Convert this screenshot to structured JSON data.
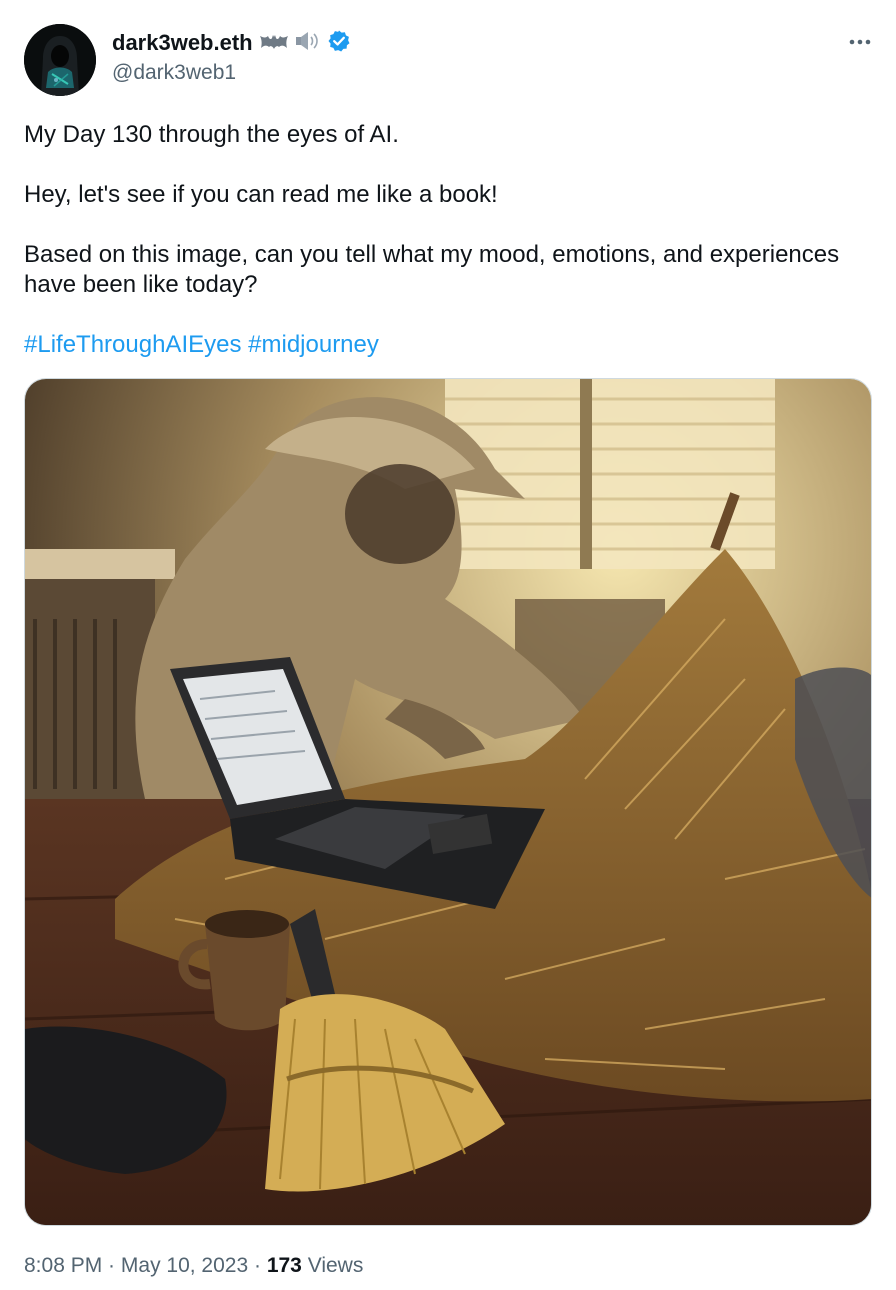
{
  "user": {
    "display_name": "dark3web.eth",
    "handle": "@dark3web1",
    "name_icons": [
      "bat-emoji-icon",
      "speaker-emoji-icon",
      "verified-badge-icon"
    ],
    "verified_color": "#1d9bf0"
  },
  "tweet": {
    "paragraph_1": "My Day 130 through the eyes of AI.",
    "paragraph_2": "Hey, let's see if you can read me like a book!",
    "paragraph_3": "Based on this image, can you tell what my mood, emotions, and experiences have been like today?",
    "hashtags": [
      "#LifeThroughAIEyes",
      "#midjourney"
    ],
    "hashtag_separator": " "
  },
  "media": {
    "kind": "image"
  },
  "meta": {
    "time": "8:08 PM",
    "separator_1": " · ",
    "date": "May 10, 2023",
    "separator_2": " · ",
    "views_count": "173",
    "views_label": " Views"
  },
  "colors": {
    "text_primary": "#0f1419",
    "text_secondary": "#536471",
    "link": "#1d9bf0"
  }
}
